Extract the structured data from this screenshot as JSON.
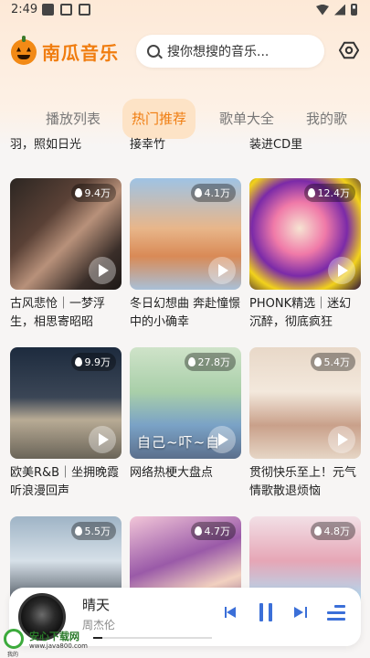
{
  "status_bar": {
    "time": "2:49"
  },
  "header": {
    "app_name": "南瓜音乐",
    "search_placeholder": "搜你想搜的音乐..."
  },
  "tabs": [
    {
      "label": "播放列表",
      "active": false
    },
    {
      "label": "热门推荐",
      "active": true
    },
    {
      "label": "歌单大全",
      "active": false
    },
    {
      "label": "我的歌",
      "active": false
    }
  ],
  "cut_row": [
    "羽，照如日光",
    "接幸竹",
    "装进CD里"
  ],
  "playlists": [
    {
      "plays": "9.4万",
      "title": "古风悲怆｜一梦浮生，相思寄昭昭"
    },
    {
      "plays": "4.1万",
      "title": "冬日幻想曲 奔赴憧憬中的小确幸"
    },
    {
      "plays": "12.4万",
      "title": "PHONK精选｜迷幻沉醉，彻底疯狂"
    },
    {
      "plays": "9.9万",
      "title": "欧美R&B｜坐拥晚霞听浪漫回声"
    },
    {
      "plays": "27.8万",
      "title": "网络热梗大盘点",
      "cover_text": "自己~吓~自"
    },
    {
      "plays": "5.4万",
      "title": "贯彻快乐至上！元气情歌散退烦恼"
    },
    {
      "plays": "5.5万",
      "title": ""
    },
    {
      "plays": "4.7万",
      "title": ""
    },
    {
      "plays": "4.8万",
      "title": ""
    }
  ],
  "player": {
    "song_title": "晴天",
    "artist": "周杰伦",
    "progress": 0.08
  },
  "watermark": {
    "name": "安心下载网",
    "url": "www.java800.com",
    "label": "我的"
  },
  "colors": {
    "accent": "#f07d10",
    "player_controls": "#3b6fd8"
  }
}
